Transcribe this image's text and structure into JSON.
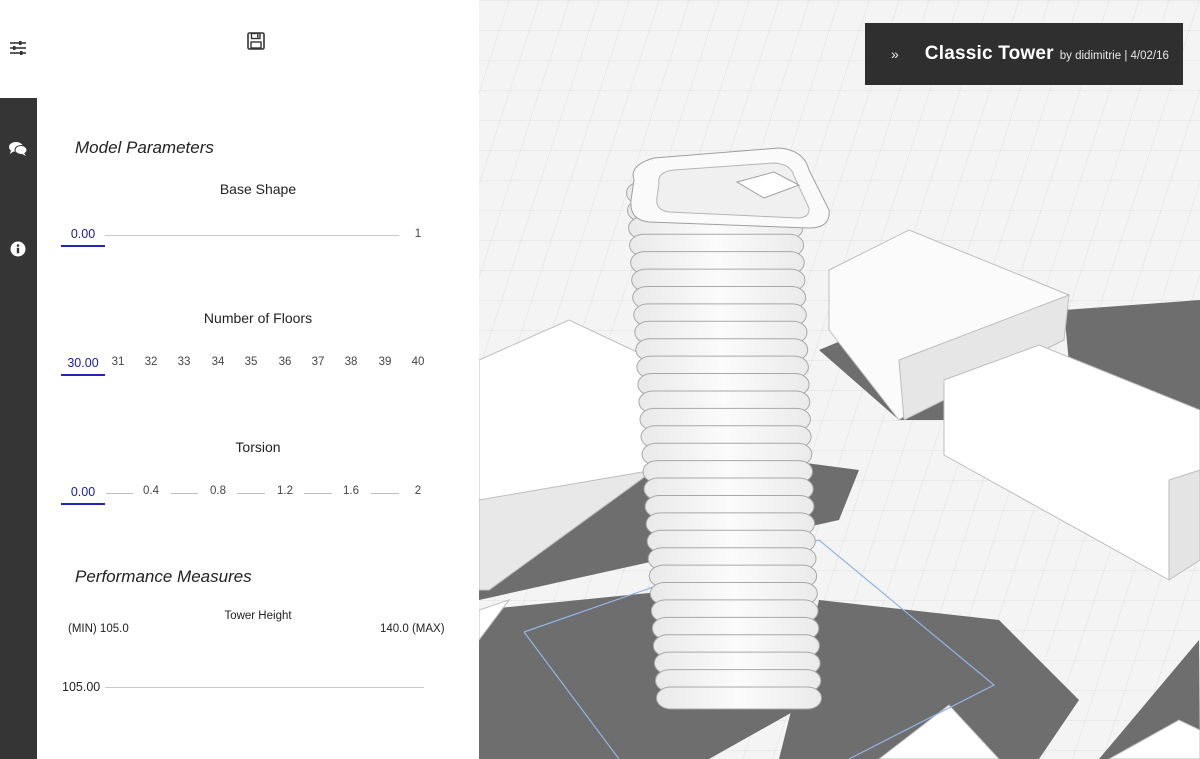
{
  "panel": {
    "section_model": "Model Parameters",
    "section_performance": "Performance Measures",
    "params": {
      "base_shape": {
        "title": "Base Shape",
        "value": "0.00",
        "ticks": [
          "1"
        ]
      },
      "floors": {
        "title": "Number of Floors",
        "value": "30.00",
        "ticks": [
          "31",
          "32",
          "33",
          "34",
          "35",
          "36",
          "37",
          "38",
          "39",
          "40"
        ]
      },
      "torsion": {
        "title": "Torsion",
        "value": "0.00",
        "ticks": [
          "0.4",
          "0.8",
          "1.2",
          "1.6",
          "2"
        ]
      }
    },
    "measure": {
      "title": "Tower Height",
      "min_label": "(MIN) 105.0",
      "max_label": "140.0 (MAX)",
      "value": "105.00"
    }
  },
  "header": {
    "title": "Classic Tower",
    "meta": "by didimitrie | 4/02/16"
  },
  "icons": {
    "rail": [
      "sliders-icon",
      "comments-icon",
      "info-icon"
    ],
    "save": "save-icon",
    "expand": "chevron-double-right-icon"
  },
  "colors": {
    "accent": "#2323c0",
    "rail": "#353535",
    "card": "#2f2f2f"
  }
}
